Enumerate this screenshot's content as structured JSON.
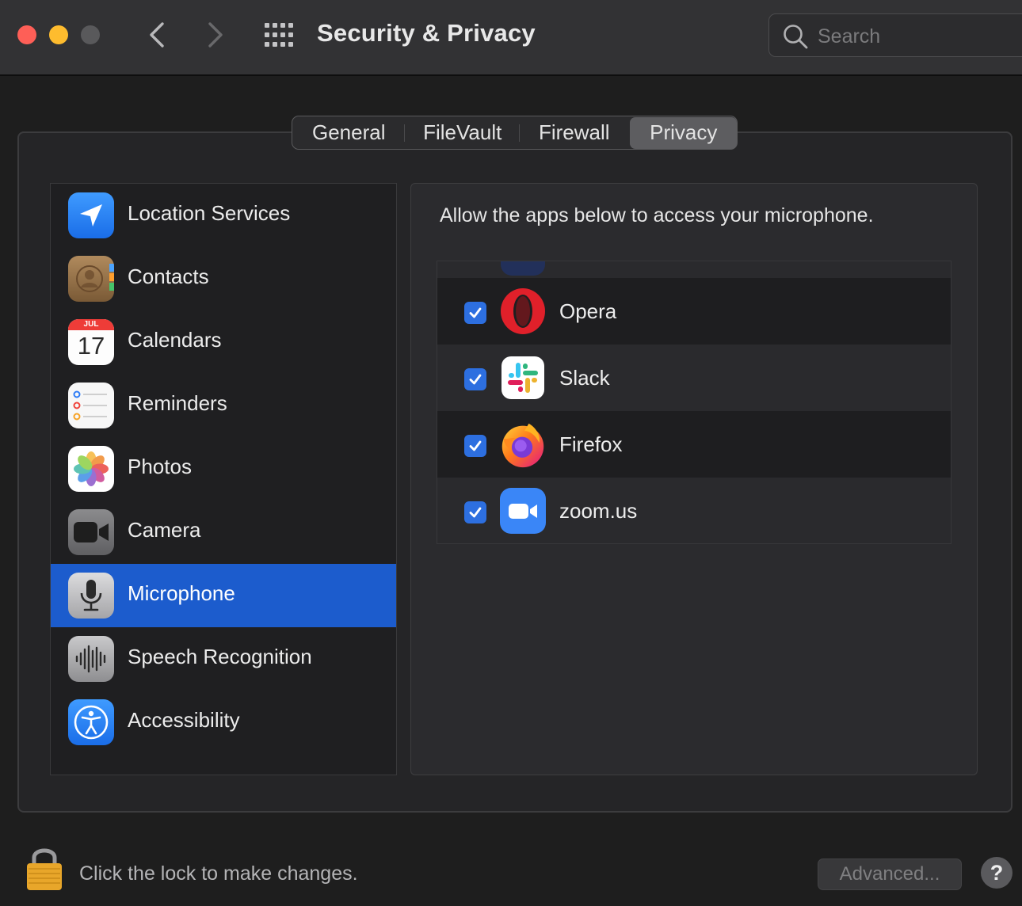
{
  "window": {
    "title": "Security & Privacy",
    "search_placeholder": "Search"
  },
  "tabs": [
    {
      "label": "General",
      "selected": false
    },
    {
      "label": "FileVault",
      "selected": false
    },
    {
      "label": "Firewall",
      "selected": false
    },
    {
      "label": "Privacy",
      "selected": true
    }
  ],
  "sidebar": {
    "items": [
      {
        "label": "Location Services",
        "icon": "location-arrow-icon",
        "selected": false
      },
      {
        "label": "Contacts",
        "icon": "contacts-icon",
        "selected": false
      },
      {
        "label": "Calendars",
        "icon": "calendar-icon",
        "selected": false,
        "icon_month": "JUL",
        "icon_day": "17"
      },
      {
        "label": "Reminders",
        "icon": "reminders-icon",
        "selected": false
      },
      {
        "label": "Photos",
        "icon": "photos-icon",
        "selected": false
      },
      {
        "label": "Camera",
        "icon": "camera-icon",
        "selected": false
      },
      {
        "label": "Microphone",
        "icon": "microphone-icon",
        "selected": true
      },
      {
        "label": "Speech Recognition",
        "icon": "waveform-icon",
        "selected": false
      },
      {
        "label": "Accessibility",
        "icon": "accessibility-icon",
        "selected": false
      }
    ]
  },
  "pane": {
    "description": "Allow the apps below to access your microphone.",
    "apps": [
      {
        "name": "Opera",
        "checked": true,
        "icon": "opera-icon"
      },
      {
        "name": "Slack",
        "checked": true,
        "icon": "slack-icon"
      },
      {
        "name": "Firefox",
        "checked": true,
        "icon": "firefox-icon"
      },
      {
        "name": "zoom.us",
        "checked": true,
        "icon": "zoom-icon"
      }
    ]
  },
  "footer": {
    "lock_text": "Click the lock to make changes.",
    "advanced_label": "Advanced...",
    "help_label": "?"
  },
  "colors": {
    "selection": "#1c5ccd",
    "checkbox": "#2d6fe0",
    "close": "#fe5f57",
    "minimize": "#febc2e"
  }
}
